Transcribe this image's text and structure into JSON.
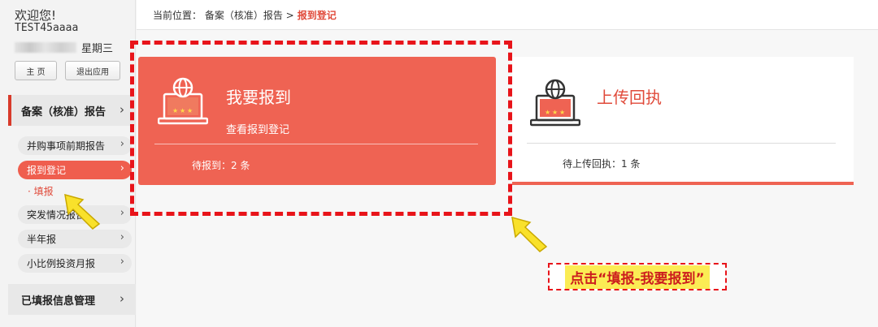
{
  "sidebar": {
    "welcome": "欢迎您!",
    "username": "TEST45aaaa",
    "weekday": "星期三",
    "home_button": "主 页",
    "exit_button": "退出应用",
    "section_filing": "备案（核准）报告",
    "menu_items": [
      {
        "label": "并购事项前期报告"
      },
      {
        "label": "报到登记"
      },
      {
        "label": "突发情况报告"
      },
      {
        "label": "半年报"
      },
      {
        "label": "小比例投资月报"
      }
    ],
    "sub_item": "· 填报",
    "section_filled": "已填报信息管理"
  },
  "breadcrumb": {
    "prefix": "当前位置： 备案（核准）报告 >",
    "current": "报到登记"
  },
  "cards": [
    {
      "title": "我要报到",
      "subtitle": "查看报到登记",
      "count_text": "待报到：2 条"
    },
    {
      "title": "上传回执",
      "count_text": "待上传回执：1 条"
    }
  ],
  "annotation": {
    "callout_text": "点击“填报-我要报到”"
  },
  "colors": {
    "accent": "#ef6353",
    "annotation_red": "#e8141a",
    "highlight_yellow": "#fbec54"
  }
}
